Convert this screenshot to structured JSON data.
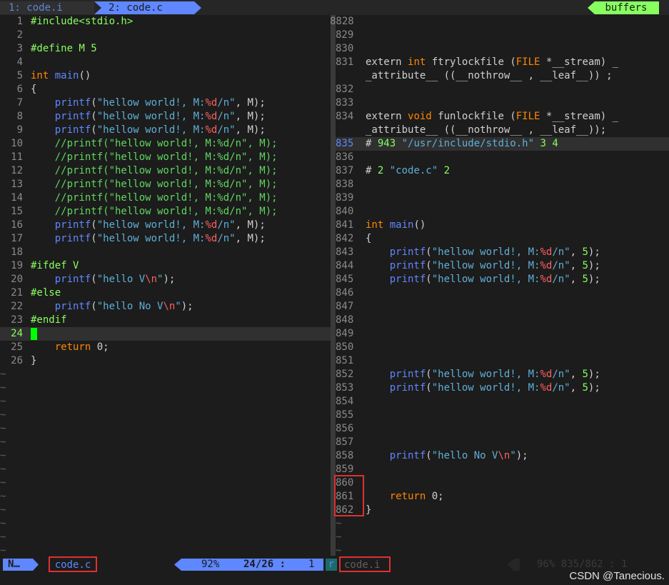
{
  "tabs": [
    {
      "label": "1: code.i"
    },
    {
      "label": "2: code.c"
    }
  ],
  "buffers_label": "buffers",
  "left_lines": [
    {
      "n": "1",
      "t": "#include<stdio.h>"
    },
    {
      "n": "2",
      "t": ""
    },
    {
      "n": "3",
      "t": "#define M 5"
    },
    {
      "n": "4",
      "t": ""
    },
    {
      "n": "5",
      "t": "int main()"
    },
    {
      "n": "6",
      "t": "{"
    },
    {
      "n": "7",
      "t": "    printf(\"hellow world!, M:%d/n\", M);"
    },
    {
      "n": "8",
      "t": "    printf(\"hellow world!, M:%d/n\", M);"
    },
    {
      "n": "9",
      "t": "    printf(\"hellow world!, M:%d/n\", M);"
    },
    {
      "n": "10",
      "t": "    //printf(\"hellow world!, M:%d/n\", M);"
    },
    {
      "n": "11",
      "t": "    //printf(\"hellow world!, M:%d/n\", M);"
    },
    {
      "n": "12",
      "t": "    //printf(\"hellow world!, M:%d/n\", M);"
    },
    {
      "n": "13",
      "t": "    //printf(\"hellow world!, M:%d/n\", M);"
    },
    {
      "n": "14",
      "t": "    //printf(\"hellow world!, M:%d/n\", M);"
    },
    {
      "n": "15",
      "t": "    //printf(\"hellow world!, M:%d/n\", M);"
    },
    {
      "n": "16",
      "t": "    printf(\"hellow world!, M:%d/n\", M);"
    },
    {
      "n": "17",
      "t": "    printf(\"hellow world!, M:%d/n\", M);"
    },
    {
      "n": "18",
      "t": ""
    },
    {
      "n": "19",
      "t": "#ifdef V"
    },
    {
      "n": "20",
      "t": "    printf(\"hello V\\n\");"
    },
    {
      "n": "21",
      "t": "#else"
    },
    {
      "n": "22",
      "t": "    printf(\"hello No V\\n\");"
    },
    {
      "n": "23",
      "t": "#endif"
    },
    {
      "n": "24",
      "t": ""
    },
    {
      "n": "25",
      "t": "    return 0;"
    },
    {
      "n": "26",
      "t": "}"
    }
  ],
  "right_lines": [
    {
      "n": "8828",
      "t": ""
    },
    {
      "n": "829",
      "t": ""
    },
    {
      "n": "830",
      "t": ""
    },
    {
      "n": "831",
      "t": "extern int ftrylockfile (FILE *__stream) _"
    },
    {
      "n": "",
      "t": "_attribute__ ((__nothrow__ , __leaf__)) ;"
    },
    {
      "n": "832",
      "t": ""
    },
    {
      "n": "833",
      "t": ""
    },
    {
      "n": "834",
      "t": "extern void funlockfile (FILE *__stream) _"
    },
    {
      "n": "",
      "t": "_attribute__ ((__nothrow__ , __leaf__));"
    },
    {
      "n": "835",
      "t": "# 943 \"/usr/include/stdio.h\" 3 4"
    },
    {
      "n": "836",
      "t": ""
    },
    {
      "n": "837",
      "t": "# 2 \"code.c\" 2"
    },
    {
      "n": "838",
      "t": ""
    },
    {
      "n": "839",
      "t": ""
    },
    {
      "n": "840",
      "t": ""
    },
    {
      "n": "841",
      "t": "int main()"
    },
    {
      "n": "842",
      "t": "{"
    },
    {
      "n": "843",
      "t": "    printf(\"hellow world!, M:%d/n\", 5);"
    },
    {
      "n": "844",
      "t": "    printf(\"hellow world!, M:%d/n\", 5);"
    },
    {
      "n": "845",
      "t": "    printf(\"hellow world!, M:%d/n\", 5);"
    },
    {
      "n": "846",
      "t": ""
    },
    {
      "n": "847",
      "t": ""
    },
    {
      "n": "848",
      "t": ""
    },
    {
      "n": "849",
      "t": ""
    },
    {
      "n": "850",
      "t": ""
    },
    {
      "n": "851",
      "t": ""
    },
    {
      "n": "852",
      "t": "    printf(\"hellow world!, M:%d/n\", 5);"
    },
    {
      "n": "853",
      "t": "    printf(\"hellow world!, M:%d/n\", 5);"
    },
    {
      "n": "854",
      "t": ""
    },
    {
      "n": "855",
      "t": ""
    },
    {
      "n": "856",
      "t": ""
    },
    {
      "n": "857",
      "t": ""
    },
    {
      "n": "858",
      "t": "    printf(\"hello No V\\n\");"
    },
    {
      "n": "859",
      "t": ""
    },
    {
      "n": "860",
      "t": ""
    },
    {
      "n": "861",
      "t": "    return 0;"
    },
    {
      "n": "862",
      "t": "}"
    }
  ],
  "left_tilde_count": 14,
  "right_tilde_count": 3,
  "status": {
    "mode": "N…",
    "file": "code.c",
    "percent": "92%",
    "rowcol": "24/26 :",
    "col": "1",
    "right_mode": "r",
    "right_file": "code.i",
    "right_pos": "96%  835/862 :  1"
  },
  "watermark": "CSDN @Tanecious.",
  "colors": {
    "accent": "#5f87ff",
    "green": "#87ff5f",
    "keyword": "#ff8700",
    "string": "#5fafd7",
    "comment": "#5fd75f",
    "highlight": "#e03030"
  }
}
